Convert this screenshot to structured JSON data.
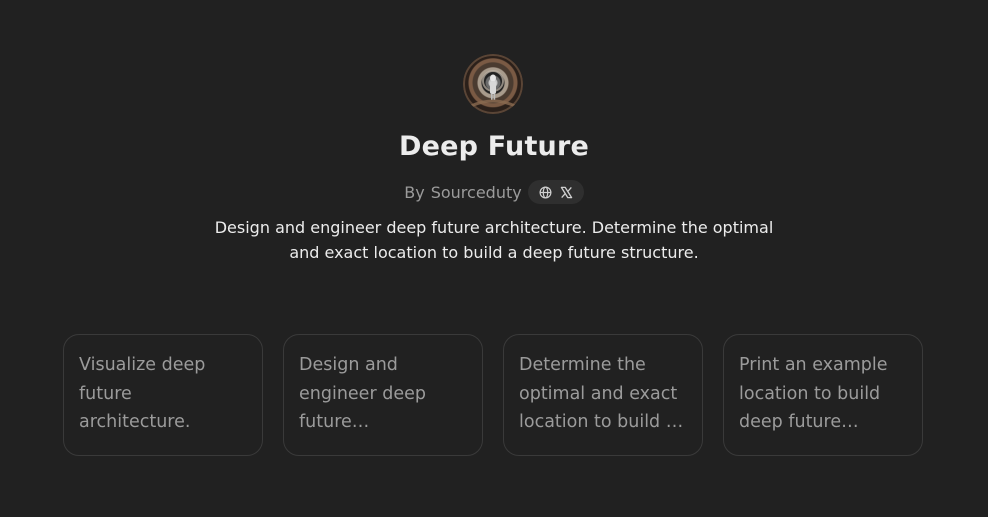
{
  "gpt": {
    "name": "Deep Future",
    "author_prefix": "By",
    "author": "Sourceduty",
    "description": "Design and engineer deep future architecture. Determine the optimal and exact location to build a deep future structure."
  },
  "social_links": {
    "icons": [
      "globe-icon",
      "x-logo-icon"
    ]
  },
  "conversation_starters": [
    {
      "label": "Visualize deep future architecture."
    },
    {
      "label": "Design and engineer deep future architecture."
    },
    {
      "label": "Determine the optimal and exact location to build a deep future structure."
    },
    {
      "label": "Print an example location to build deep future architecture."
    }
  ],
  "colors": {
    "background": "#212121",
    "title_text": "#ececec",
    "muted_text": "#9b9b9b",
    "card_border": "#3a3a3a",
    "pill_background": "#2f2f2f"
  }
}
